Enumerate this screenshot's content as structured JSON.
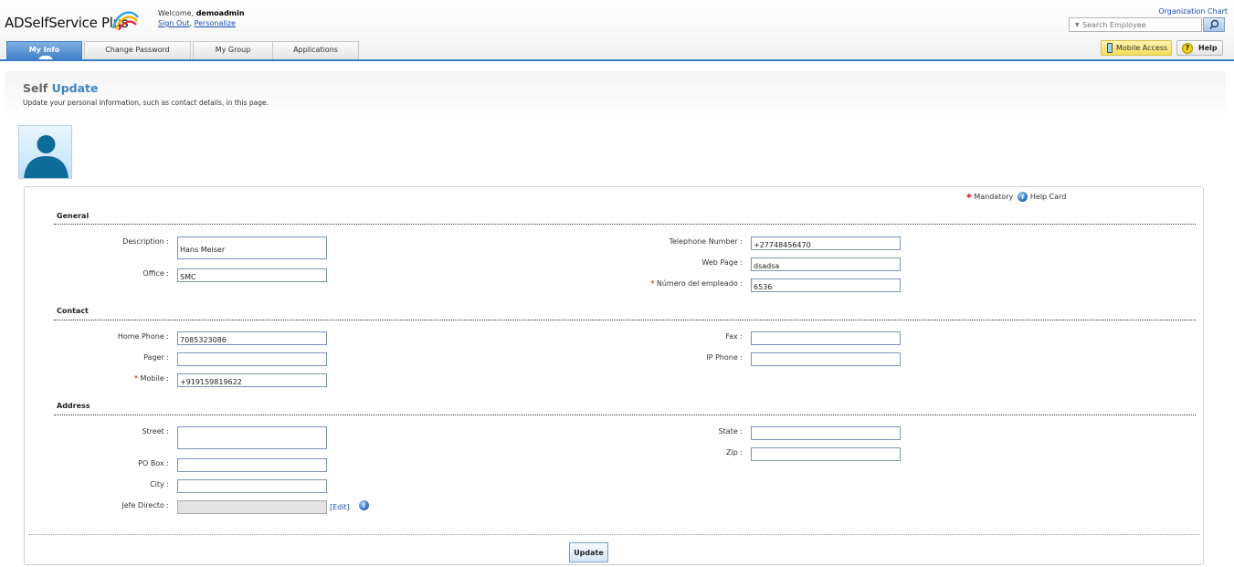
{
  "header": {
    "logo": "ADSelfService Plus",
    "welcome_prefix": "Welcome,",
    "username": "demoadmin",
    "sign_out": "Sign Out",
    "separator": ",",
    "personalize": "Personalize",
    "org_chart": "Organization Chart",
    "search_placeholder": "Search Employee",
    "mobile_access": "Mobile Access",
    "help": "Help"
  },
  "tabs": [
    {
      "label": "My Info",
      "active": true
    },
    {
      "label": "Change Password",
      "active": false
    },
    {
      "label": "My Group",
      "active": false
    },
    {
      "label": "Applications",
      "active": false
    }
  ],
  "page": {
    "title_a": "Self",
    "title_b": "Update",
    "description": "Update your personal information, such as contact details, in this page."
  },
  "legend": {
    "mandatory": "Mandatory",
    "help_card": "Help Card"
  },
  "sections": {
    "general": "General",
    "contact": "Contact",
    "address": "Address"
  },
  "fields": {
    "description": {
      "label": "Description :",
      "value": "Hans Meiser"
    },
    "office": {
      "label": "Office :",
      "value": "SMC"
    },
    "telephone": {
      "label": "Telephone Number :",
      "value": "+27748456470"
    },
    "web_page": {
      "label": "Web Page :",
      "value": "dsadsa"
    },
    "employee_number": {
      "label": "Número del empleado :",
      "value": "6536",
      "required": true
    },
    "home_phone": {
      "label": "Home Phone :",
      "value": "7085323086"
    },
    "pager": {
      "label": "Pager :",
      "value": ""
    },
    "mobile": {
      "label": "Mobile :",
      "value": "+919159819622",
      "required": true
    },
    "fax": {
      "label": "Fax :",
      "value": ""
    },
    "ip_phone": {
      "label": "IP Phone :",
      "value": ""
    },
    "street": {
      "label": "Street :",
      "value": ""
    },
    "po_box": {
      "label": "PO Box :",
      "value": ""
    },
    "city": {
      "label": "City :",
      "value": ""
    },
    "jefe_directo": {
      "label": "Jefe Directo :",
      "value": "",
      "edit": "[Edit]"
    },
    "state": {
      "label": "State :",
      "value": ""
    },
    "zip": {
      "label": "Zip :",
      "value": ""
    }
  },
  "required_marker": "*",
  "update_button": "Update",
  "colors": {
    "accent": "#3d86c6",
    "tab_active": "#3d7fc6",
    "required": "#d40000",
    "link": "#1a4fb0"
  },
  "icons": [
    "search-icon",
    "mobile-phone-icon",
    "help-icon",
    "user-avatar-icon",
    "info-icon",
    "required-star-icon"
  ]
}
